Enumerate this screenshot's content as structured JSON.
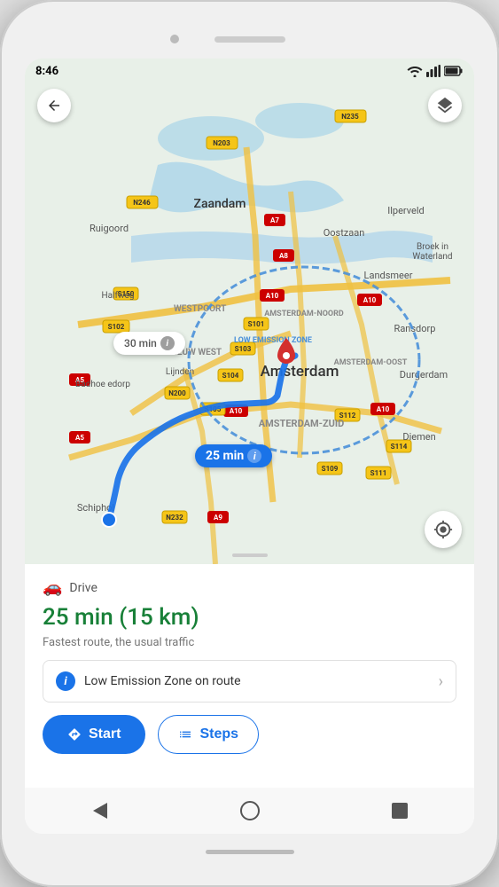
{
  "status_bar": {
    "time": "8:46",
    "signal": "▲",
    "wifi": "wifi",
    "battery": "battery"
  },
  "map": {
    "back_label": "←",
    "layers_label": "layers",
    "location_label": "⊕",
    "badge_main": "25 min",
    "badge_alt": "30 min",
    "badge_info": "i",
    "low_emission_zone_label": "LOW EMISSION ZONE"
  },
  "bottom_panel": {
    "drive_label": "Drive",
    "duration": "25 min (15 km)",
    "traffic_note": "Fastest route, the usual traffic",
    "lez_label": "Low Emission Zone on route",
    "lez_info": "i",
    "start_label": "Start",
    "steps_label": "Steps"
  },
  "nav_bar": {
    "back_label": "back",
    "home_label": "home",
    "recent_label": "recent"
  }
}
